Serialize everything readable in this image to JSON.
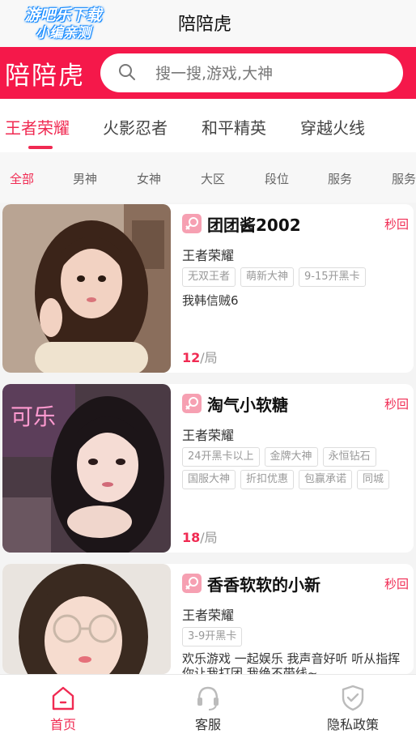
{
  "watermark": {
    "line1": "游吧乐下载",
    "line2": "小编亲测"
  },
  "header": {
    "title": "陪陪虎"
  },
  "brand": {
    "logo_text": "陪陪虎"
  },
  "search": {
    "placeholder": "搜一搜,游戏,大神"
  },
  "game_tabs": [
    "王者荣耀",
    "火影忍者",
    "和平精英",
    "穿越火线"
  ],
  "filters": [
    "全部",
    "男神",
    "女神",
    "大区",
    "段位",
    "服务",
    "服务"
  ],
  "cards": [
    {
      "name": "团团酱2002",
      "reply": "秒回",
      "game": "王者荣耀",
      "tags": [
        "无双王者",
        "萌新大神",
        "9-15开黑卡"
      ],
      "desc": "我韩信贼6",
      "price": "12",
      "unit": "/局"
    },
    {
      "name": "淘气小软糖",
      "reply": "秒回",
      "game": "王者荣耀",
      "tags": [
        "24开黑卡以上",
        "金牌大神",
        "永恒钻石",
        "国服大神",
        "折扣优惠",
        "包赢承诺",
        "同城"
      ],
      "desc": "",
      "price": "18",
      "unit": "/局"
    },
    {
      "name": "香香软软的小新",
      "reply": "秒回",
      "game": "王者荣耀",
      "tags": [
        "3-9开黑卡"
      ],
      "desc": "欢乐游戏 一起娱乐 我声音好听 听从指挥 你让我打团 我绝不带线~",
      "price": "",
      "unit": ""
    }
  ],
  "bottom_nav": [
    {
      "label": "首页",
      "icon": "home-icon"
    },
    {
      "label": "客服",
      "icon": "headset-icon"
    },
    {
      "label": "隐私政策",
      "icon": "shield-check-icon"
    }
  ],
  "colors": {
    "accent": "#f02a52",
    "brand_bar": "#f5184a"
  }
}
